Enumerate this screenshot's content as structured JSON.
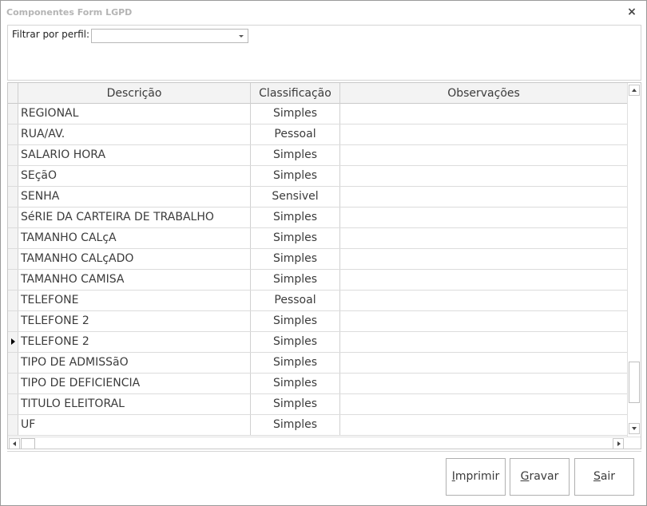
{
  "window": {
    "title": "Componentes Form LGPD",
    "close_glyph": "×"
  },
  "filter": {
    "label": "Filtrar por perfil:",
    "value": ""
  },
  "grid": {
    "columns": [
      "Descrição",
      "Classificação",
      "Observações"
    ],
    "rows": [
      {
        "descricao": "REGIONAL",
        "classificacao": "Simples",
        "observacoes": ""
      },
      {
        "descricao": "RUA/AV.",
        "classificacao": "Pessoal",
        "observacoes": ""
      },
      {
        "descricao": "SALARIO HORA",
        "classificacao": "Simples",
        "observacoes": ""
      },
      {
        "descricao": "SEçãO",
        "classificacao": "Simples",
        "observacoes": ""
      },
      {
        "descricao": "SENHA",
        "classificacao": "Sensivel",
        "observacoes": ""
      },
      {
        "descricao": "SéRIE DA CARTEIRA DE TRABALHO",
        "classificacao": "Simples",
        "observacoes": ""
      },
      {
        "descricao": "TAMANHO CALçA",
        "classificacao": "Simples",
        "observacoes": ""
      },
      {
        "descricao": "TAMANHO CALçADO",
        "classificacao": "Simples",
        "observacoes": ""
      },
      {
        "descricao": "TAMANHO CAMISA",
        "classificacao": "Simples",
        "observacoes": ""
      },
      {
        "descricao": "TELEFONE",
        "classificacao": "Pessoal",
        "observacoes": ""
      },
      {
        "descricao": "TELEFONE 2",
        "classificacao": "Simples",
        "observacoes": ""
      },
      {
        "descricao": "TELEFONE 2",
        "classificacao": "Simples",
        "observacoes": "",
        "current": true
      },
      {
        "descricao": "TIPO DE ADMISSãO",
        "classificacao": "Simples",
        "observacoes": ""
      },
      {
        "descricao": "TIPO DE DEFICIENCIA",
        "classificacao": "Simples",
        "observacoes": ""
      },
      {
        "descricao": "TITULO ELEITORAL",
        "classificacao": "Simples",
        "observacoes": ""
      },
      {
        "descricao": "UF",
        "classificacao": "Simples",
        "observacoes": ""
      }
    ],
    "scroll_position_fraction": 0.93
  },
  "buttons": {
    "imprimir": {
      "mnemonic": "I",
      "rest": "mprimir"
    },
    "gravar": {
      "mnemonic": "G",
      "rest": "ravar"
    },
    "sair": {
      "mnemonic": "S",
      "rest": "air"
    }
  },
  "icons": {
    "close": "close-icon",
    "dropdown": "chevron-down-icon",
    "row_pointer": "row-pointer-icon"
  },
  "colors": {
    "title_text": "#b4b4b4",
    "grid_header_bg": "#f3f3f3",
    "text": "#3b3b3b"
  }
}
